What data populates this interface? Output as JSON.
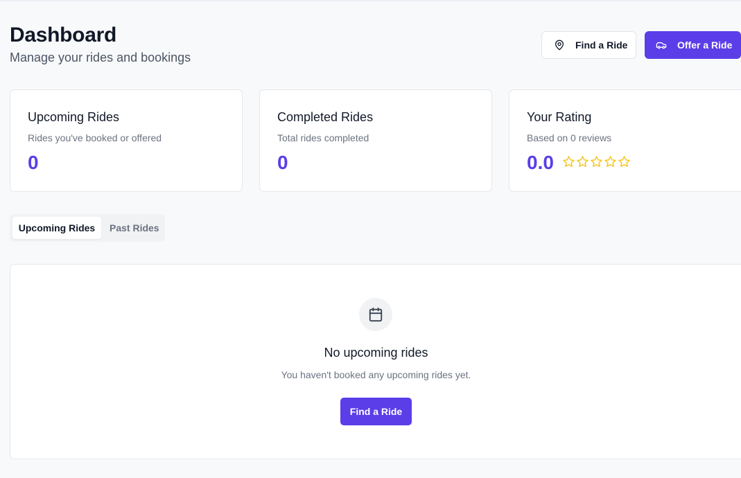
{
  "header": {
    "title": "Dashboard",
    "subtitle": "Manage your rides and bookings",
    "find_ride_label": "Find a Ride",
    "offer_ride_label": "Offer a Ride"
  },
  "stats": {
    "upcoming": {
      "title": "Upcoming Rides",
      "subtitle": "Rides you've booked or offered",
      "value": "0"
    },
    "completed": {
      "title": "Completed Rides",
      "subtitle": "Total rides completed",
      "value": "0"
    },
    "rating": {
      "title": "Your Rating",
      "subtitle": "Based on 0 reviews",
      "value": "0.0",
      "stars_filled": 0,
      "stars_total": 5
    }
  },
  "tabs": [
    {
      "label": "Upcoming Rides",
      "active": true
    },
    {
      "label": "Past Rides",
      "active": false
    }
  ],
  "empty_state": {
    "icon": "calendar-icon",
    "title": "No upcoming rides",
    "message": "You haven't booked any upcoming rides yet.",
    "button_label": "Find a Ride"
  },
  "colors": {
    "accent": "#5b3ee8",
    "star": "#f5c518",
    "background": "#f8f9fb"
  }
}
